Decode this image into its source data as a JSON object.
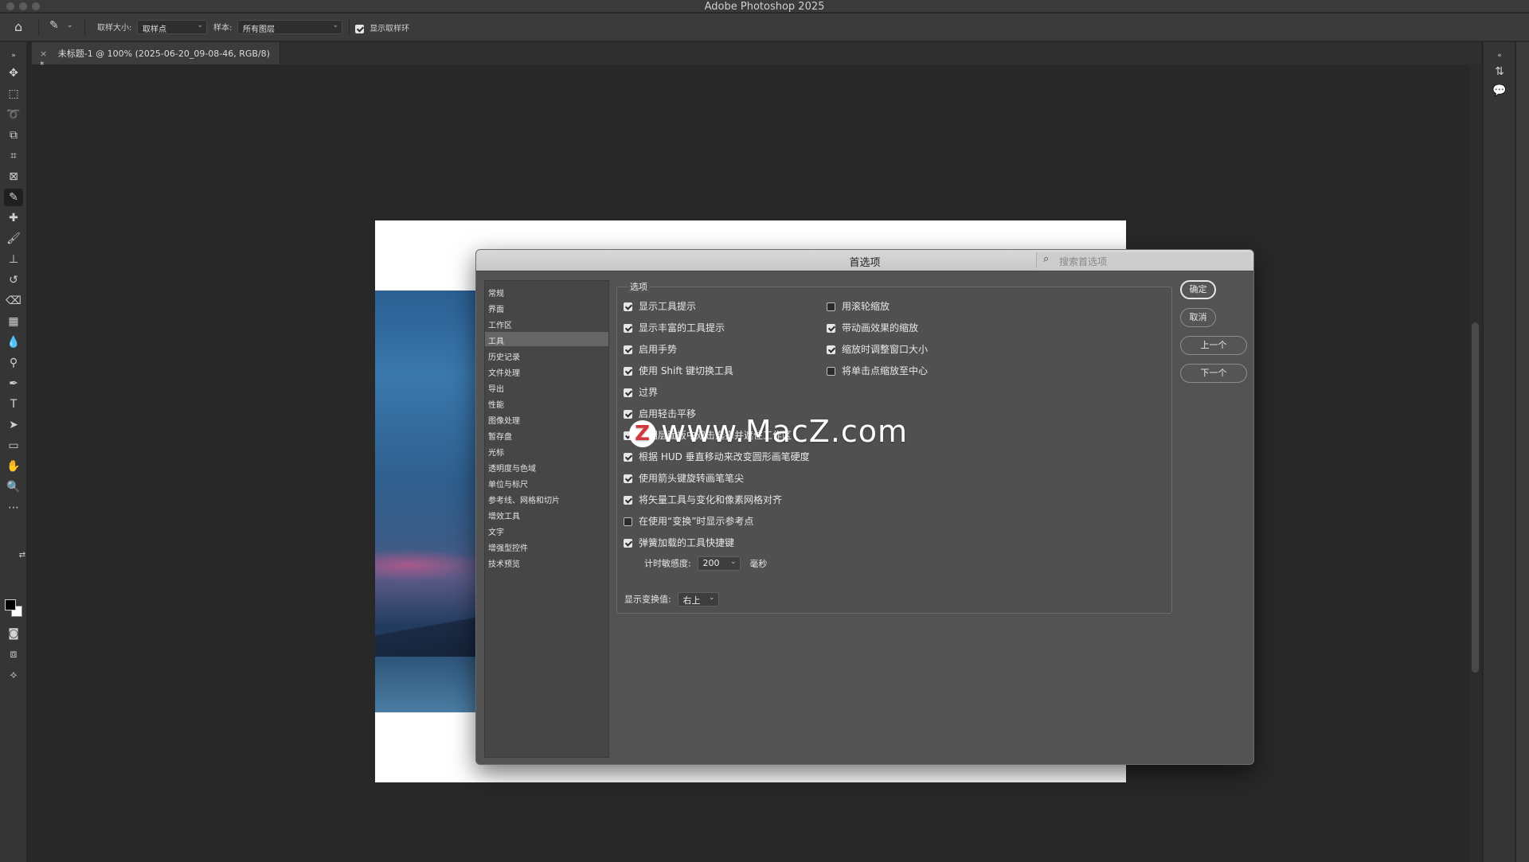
{
  "window": {
    "title": "Adobe Photoshop 2025"
  },
  "options_bar": {
    "sample_size_label": "取样大小:",
    "sample_size_value": "取样点",
    "sample_label": "样本:",
    "sample_value": "所有图层",
    "show_ring_label": "显示取样环"
  },
  "document_tab": {
    "title": "未标题-1 @ 100% (2025-06-20_09-08-46, RGB/8) *",
    "close": "×"
  },
  "dialog": {
    "title": "首选项",
    "search_placeholder": "搜索首选项",
    "categories": [
      "常规",
      "界面",
      "工作区",
      "工具",
      "历史记录",
      "文件处理",
      "导出",
      "性能",
      "图像处理",
      "暂存盘",
      "光标",
      "透明度与色域",
      "单位与标尺",
      "参考线、网格和切片",
      "增效工具",
      "文字",
      "增强型控件",
      "技术预览"
    ],
    "selected_category": "工具",
    "group_label": "选项",
    "left_options": [
      {
        "label": "显示工具提示",
        "checked": true
      },
      {
        "label": "显示丰富的工具提示",
        "checked": true
      },
      {
        "label": "启用手势",
        "checked": true
      },
      {
        "label": "使用 Shift 键切换工具",
        "checked": true
      },
      {
        "label": "过界",
        "checked": true
      },
      {
        "label": "启用轻击平移",
        "checked": true
      },
      {
        "label": "在图层面板中双击选择并遮住工作区",
        "checked": true
      },
      {
        "label": "根据 HUD 垂直移动来改变圆形画笔硬度",
        "checked": true
      },
      {
        "label": "使用箭头键旋转画笔笔尖",
        "checked": true
      },
      {
        "label": "将矢量工具与变化和像素网格对齐",
        "checked": true
      },
      {
        "label": "在使用“变换”时显示参考点",
        "checked": false
      },
      {
        "label": "弹簧加载的工具快捷键",
        "checked": true
      }
    ],
    "right_options": [
      {
        "label": "用滚轮缩放",
        "checked": false
      },
      {
        "label": "带动画效果的缩放",
        "checked": true
      },
      {
        "label": "缩放时调整窗口大小",
        "checked": true
      },
      {
        "label": "将单击点缩放至中心",
        "checked": false
      }
    ],
    "timer_label": "计时敏感度:",
    "timer_value": "200",
    "timer_unit": "毫秒",
    "transform_label": "显示变换值:",
    "transform_value": "右上",
    "buttons": {
      "ok": "确定",
      "cancel": "取消",
      "prev": "上一个",
      "next": "下一个"
    }
  },
  "watermark": {
    "logo": "Z",
    "text": "www.MacZ.com"
  }
}
